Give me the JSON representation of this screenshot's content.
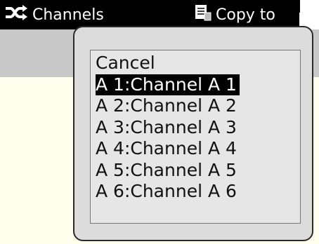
{
  "toolbar": {
    "channels_label": "Channels",
    "copy_label": "Copy to",
    "channels_icon": "shuffle-icon",
    "copy_icon": "document-icon",
    "background": "#000000",
    "text_color": "#ffffff"
  },
  "popup": {
    "items": [
      {
        "label": "Cancel",
        "selected": false
      },
      {
        "label": "A 1:Channel A 1",
        "selected": true
      },
      {
        "label": "A 2:Channel A 2",
        "selected": false
      },
      {
        "label": "A 3:Channel A 3",
        "selected": false
      },
      {
        "label": "A 4:Channel A 4",
        "selected": false
      },
      {
        "label": "A 5:Channel A 5",
        "selected": false
      },
      {
        "label": "A 6:Channel A 6",
        "selected": false
      }
    ],
    "selected_background": "#000000",
    "selected_color": "#ffffff"
  },
  "colors": {
    "band": "#c8c8c8",
    "content_background": "#ffffee",
    "popup_background": "#dcdcdc"
  }
}
